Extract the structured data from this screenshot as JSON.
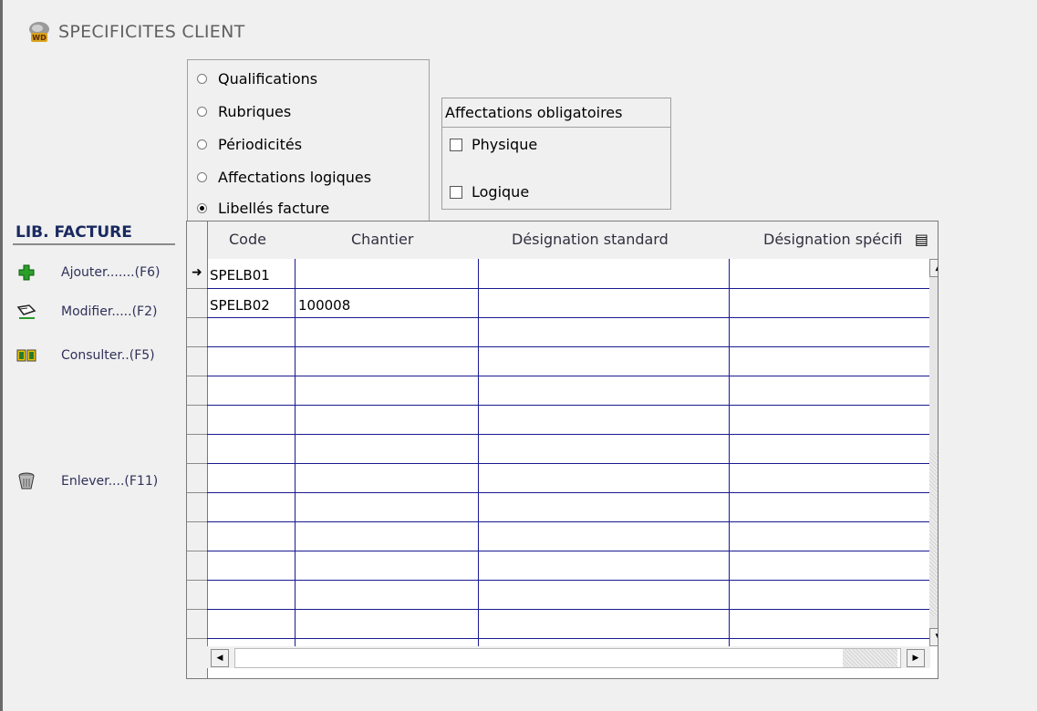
{
  "window": {
    "title": "SPECIFICITES CLIENT",
    "icon": "wd-app-icon"
  },
  "radios": [
    {
      "label": "Qualifications",
      "checked": false
    },
    {
      "label": "Rubriques",
      "checked": false
    },
    {
      "label": "Périodicités",
      "checked": false
    },
    {
      "label": "Affectations logiques",
      "checked": false
    },
    {
      "label": "Libellés facture",
      "checked": true
    }
  ],
  "affectations": {
    "title": "Affectations obligatoires",
    "physique": {
      "label": "Physique",
      "checked": false
    },
    "logique": {
      "label": "Logique",
      "checked": false
    }
  },
  "panel": {
    "title": "LIB. FACTURE",
    "actions": [
      {
        "label": "Ajouter.......(F6)",
        "icon": "plus-icon"
      },
      {
        "label": "Modifier.....(F2)",
        "icon": "edit-icon"
      },
      {
        "label": "Consulter..(F5)",
        "icon": "book-icon"
      },
      {
        "label": "Enlever....(F11)",
        "icon": "trash-icon"
      }
    ]
  },
  "table": {
    "columns": [
      "Code",
      "Chantier",
      "Désignation standard",
      "Désignation spécifi"
    ],
    "rows": [
      {
        "code": "SPELB01",
        "chantier": ""
      },
      {
        "code": "SPELB02",
        "chantier": "100008"
      }
    ],
    "current_row_marker": "➜"
  },
  "colors": {
    "grid_lines": "#1a1a90",
    "background": "#f0f0f0",
    "panel_title": "#1a2a60"
  }
}
